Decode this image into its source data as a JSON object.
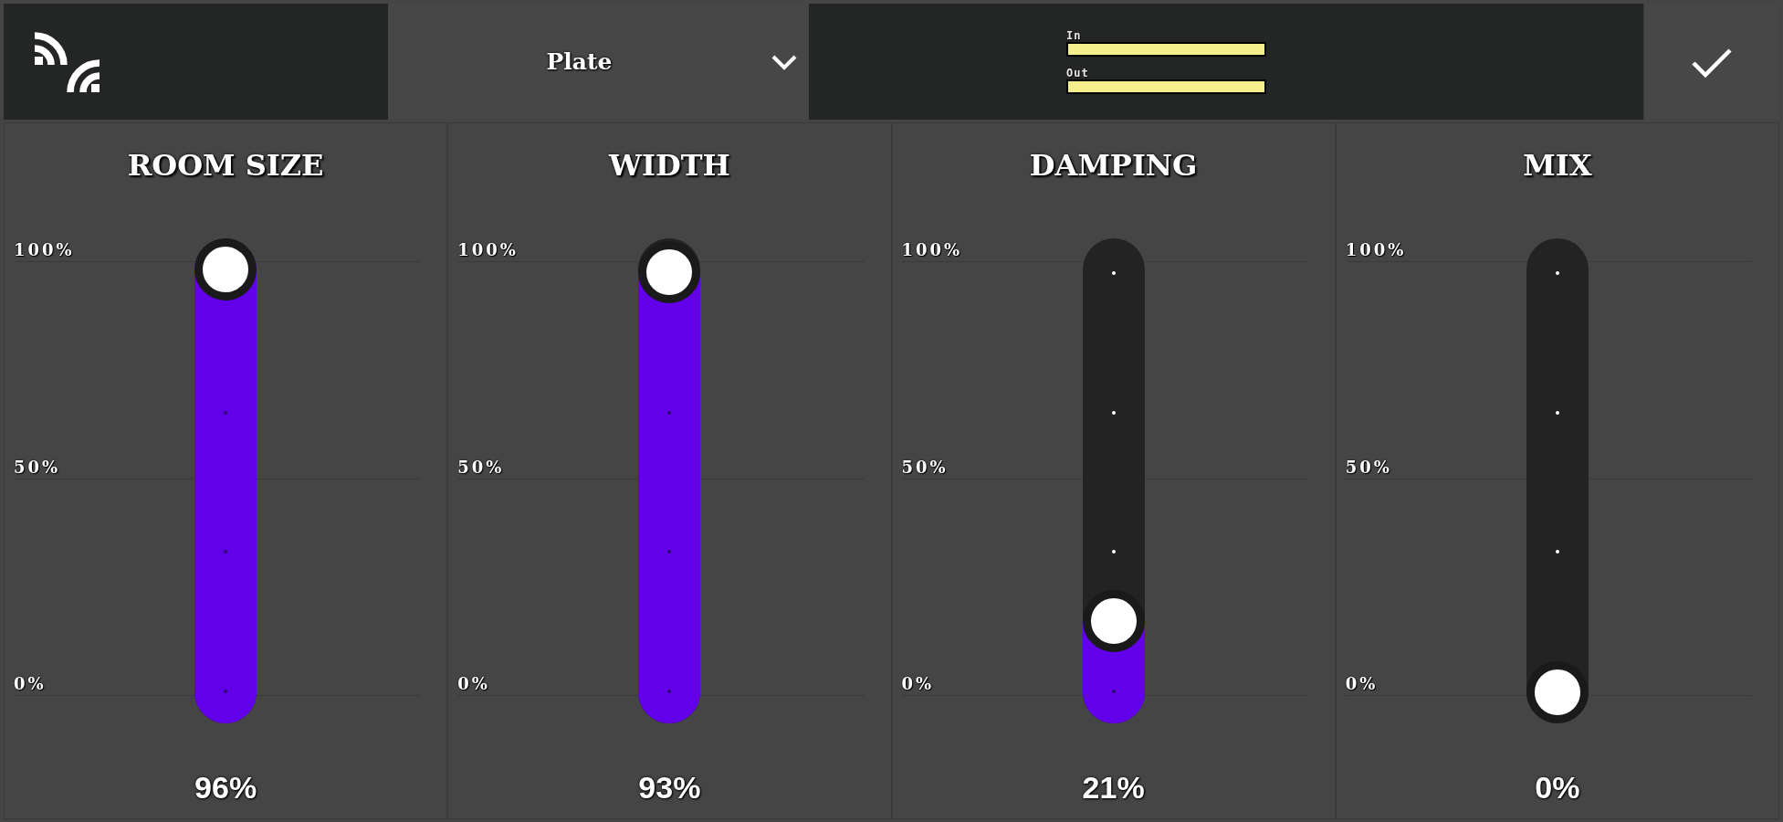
{
  "header": {
    "preset": {
      "label": "Plate"
    },
    "meters": [
      {
        "label": "In",
        "level": 1
      },
      {
        "label": "Out",
        "level": 1
      }
    ]
  },
  "sliders": [
    {
      "title": "ROOM SIZE",
      "scale": [
        "100%",
        "50%",
        "0%"
      ],
      "level": 0.96,
      "reading": "96%"
    },
    {
      "title": "WIDTH",
      "scale": [
        "100%",
        "50%",
        "0%"
      ],
      "level": 0.93,
      "reading": "93%"
    },
    {
      "title": "DAMPING",
      "scale": [
        "100%",
        "50%",
        "0%"
      ],
      "level": 0.21,
      "reading": "21%"
    },
    {
      "title": "MIX",
      "scale": [
        "100%",
        "50%",
        "0%"
      ],
      "level": 0,
      "reading": "0%"
    }
  ]
}
